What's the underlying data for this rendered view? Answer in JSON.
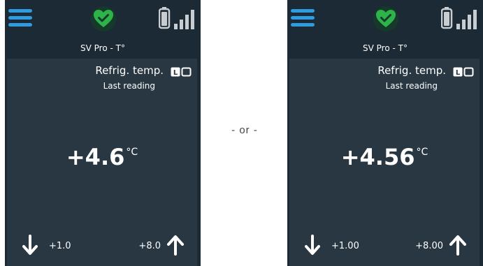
{
  "separator": "- or -",
  "colors": {
    "device_background": "#1b2a34",
    "screen_background": "#283741",
    "menu_blue": "#2f9be0",
    "heart_green": "#2db34a",
    "text": "#ffffff"
  },
  "devices": [
    {
      "header": {
        "menu_icon": "menu-icon",
        "status_icon": "heart-check-icon",
        "battery_icon": "battery-icon",
        "signal_icon": "signal-bars-icon"
      },
      "device_name": "SV Pro - T°",
      "screen": {
        "title": "Refrig. temp.",
        "subtitle": "Last reading",
        "mode_icon": "mode-toggle-icon",
        "mode_letter": "L",
        "value": "+4.6",
        "unit": "°C",
        "low_limit": "+1.0",
        "high_limit": "+8.0"
      }
    },
    {
      "header": {
        "menu_icon": "menu-icon",
        "status_icon": "heart-check-icon",
        "battery_icon": "battery-icon",
        "signal_icon": "signal-bars-icon"
      },
      "device_name": "SV Pro - T°",
      "screen": {
        "title": "Refrig. temp.",
        "subtitle": "Last reading",
        "mode_icon": "mode-toggle-icon",
        "mode_letter": "L",
        "value": "+4.56",
        "unit": "°C",
        "low_limit": "+1.00",
        "high_limit": "+8.00"
      }
    }
  ]
}
